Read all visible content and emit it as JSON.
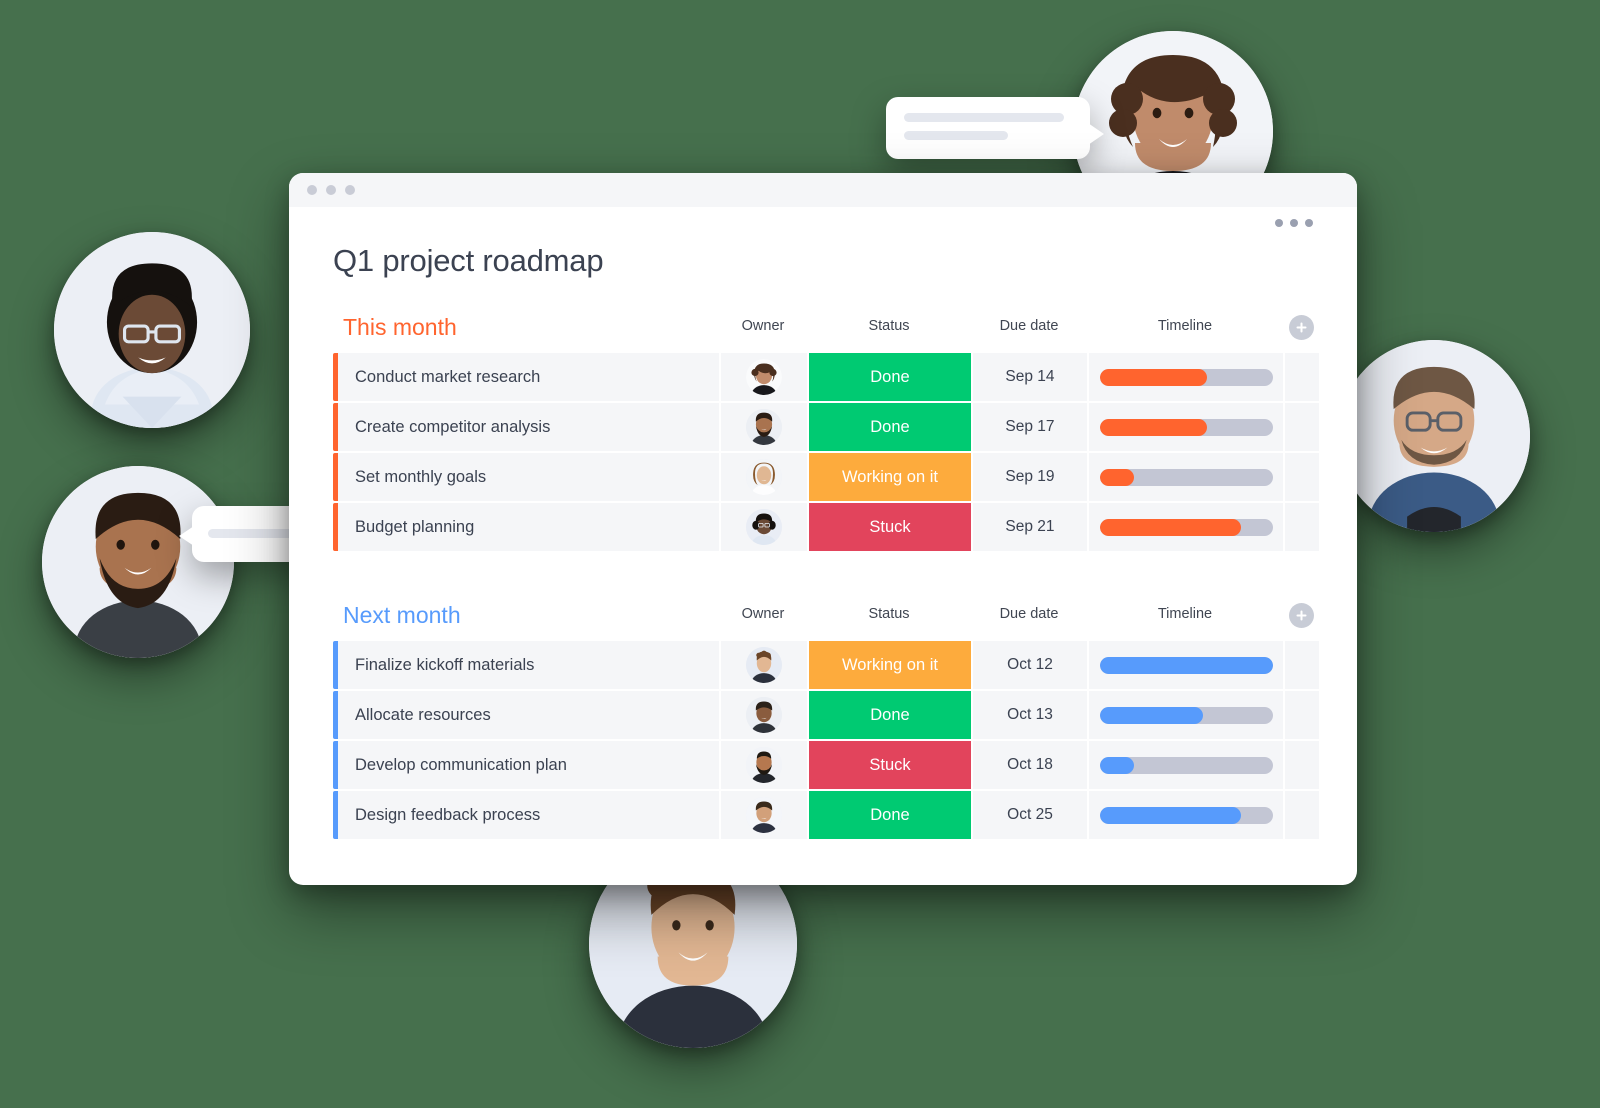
{
  "window": {
    "traffic_lights": [
      "dot",
      "dot",
      "dot"
    ],
    "title": "Q1 project roadmap",
    "menu_icon": "kebab-menu-icon"
  },
  "columns": {
    "owner": "Owner",
    "status": "Status",
    "due_date": "Due date",
    "timeline": "Timeline",
    "add_icon": "plus-circle-icon"
  },
  "colors": {
    "accent_orange": "#ff642e",
    "accent_blue": "#579bfc",
    "status_done": "#00ca72",
    "status_working": "#fdab3d",
    "status_stuck": "#e2445c",
    "track": "#c3c6d4",
    "row_bg": "#f5f6f8",
    "page_bg": "#46704d"
  },
  "groups": [
    {
      "title": "This month",
      "color": "#ff642e",
      "bar_color": "#ff642e",
      "rows": [
        {
          "name": "Conduct market research",
          "owner": "avatar-woman-curly-hair",
          "status": "Done",
          "status_color": "#00ca72",
          "due_date": "Sep 14",
          "progress": 62
        },
        {
          "name": "Create competitor analysis",
          "owner": "avatar-man-beard",
          "status": "Done",
          "status_color": "#00ca72",
          "due_date": "Sep 17",
          "progress": 62
        },
        {
          "name": "Set monthly goals",
          "owner": "avatar-woman-long-hair",
          "status": "Working on it",
          "status_color": "#fdab3d",
          "due_date": "Sep 19",
          "progress": 20
        },
        {
          "name": "Budget planning",
          "owner": "avatar-woman-glasses",
          "status": "Stuck",
          "status_color": "#e2445c",
          "due_date": "Sep 21",
          "progress": 82
        }
      ]
    },
    {
      "title": "Next month",
      "color": "#579bfc",
      "bar_color": "#579bfc",
      "rows": [
        {
          "name": "Finalize kickoff materials",
          "owner": "avatar-man-curly-hair",
          "status": "Working on it",
          "status_color": "#fdab3d",
          "due_date": "Oct 12",
          "progress": 100
        },
        {
          "name": "Allocate resources",
          "owner": "avatar-man-short-hair",
          "status": "Done",
          "status_color": "#00ca72",
          "due_date": "Oct 13",
          "progress": 60
        },
        {
          "name": "Develop communication plan",
          "owner": "avatar-man-bald-beard",
          "status": "Stuck",
          "status_color": "#e2445c",
          "due_date": "Oct 18",
          "progress": 20
        },
        {
          "name": "Design feedback process",
          "owner": "avatar-man-smiling",
          "status": "Done",
          "status_color": "#00ca72",
          "due_date": "Oct 25",
          "progress": 82
        }
      ]
    }
  ],
  "floating_avatars": [
    {
      "id": "avatar-top-right",
      "name": "avatar-woman-curly-hair",
      "skin": "#c08b6b",
      "hair": "#4a2f1f",
      "shirt": "#1b1b1f"
    },
    {
      "id": "avatar-left-top",
      "name": "avatar-woman-glasses",
      "skin": "#6b4a36",
      "hair": "#16120f",
      "shirt": "#cfd9e6"
    },
    {
      "id": "avatar-left-bottom",
      "name": "avatar-man-beard",
      "skin": "#a9734f",
      "hair": "#2a1c13",
      "shirt": "#3a3f45"
    },
    {
      "id": "avatar-right",
      "name": "avatar-man-glasses",
      "skin": "#d5a887",
      "hair": "#6e5744",
      "shirt": "#3b5b86"
    },
    {
      "id": "avatar-bottom",
      "name": "avatar-man-curly-hair",
      "skin": "#e2b793",
      "hair": "#6b4528",
      "shirt": "#2b303c"
    }
  ],
  "chat_bubbles": [
    {
      "id": "chat-bubble-top",
      "lines": 2,
      "tail": "right"
    },
    {
      "id": "chat-bubble-left",
      "lines": 1,
      "tail": "left"
    }
  ]
}
